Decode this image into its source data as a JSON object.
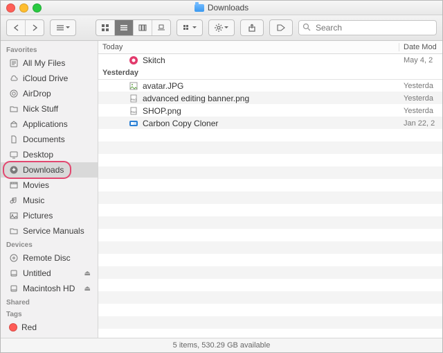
{
  "window": {
    "title": "Downloads"
  },
  "toolbar": {
    "search_placeholder": "Search"
  },
  "columns": {
    "name": "Today",
    "date": "Date Mod"
  },
  "sidebar": {
    "sections": {
      "favorites": "Favorites",
      "devices": "Devices",
      "shared": "Shared",
      "tags": "Tags"
    },
    "favorites": [
      {
        "icon": "all-my-files",
        "label": "All My Files"
      },
      {
        "icon": "cloud",
        "label": "iCloud Drive"
      },
      {
        "icon": "airdrop",
        "label": "AirDrop"
      },
      {
        "icon": "folder",
        "label": "Nick Stuff"
      },
      {
        "icon": "applications",
        "label": "Applications"
      },
      {
        "icon": "documents",
        "label": "Documents"
      },
      {
        "icon": "desktop",
        "label": "Desktop"
      },
      {
        "icon": "downloads",
        "label": "Downloads",
        "selected": true,
        "highlighted": true
      },
      {
        "icon": "movies",
        "label": "Movies"
      },
      {
        "icon": "music",
        "label": "Music"
      },
      {
        "icon": "pictures",
        "label": "Pictures"
      },
      {
        "icon": "folder",
        "label": "Service Manuals"
      }
    ],
    "devices": [
      {
        "icon": "remote-disc",
        "label": "Remote Disc"
      },
      {
        "icon": "disk",
        "label": "Untitled",
        "ejectable": true
      },
      {
        "icon": "disk",
        "label": "Macintosh HD",
        "ejectable": true
      }
    ],
    "tags": [
      {
        "color": "#ff5b56",
        "label": "Red"
      }
    ]
  },
  "groups": [
    {
      "label": "Today",
      "items": [
        {
          "icon": "skitch",
          "name": "Skitch",
          "date": "May 4, 2"
        }
      ]
    },
    {
      "label": "Yesterday",
      "items": [
        {
          "icon": "image",
          "name": "avatar.JPG",
          "date": "Yesterda"
        },
        {
          "icon": "png",
          "name": "advanced editing banner.png",
          "date": "Yesterda"
        },
        {
          "icon": "png",
          "name": "SHOP.png",
          "date": "Yesterda"
        },
        {
          "icon": "ccc",
          "name": "Carbon Copy Cloner",
          "date": "Jan 22, 2"
        }
      ]
    }
  ],
  "status": "5 items, 530.29 GB available"
}
